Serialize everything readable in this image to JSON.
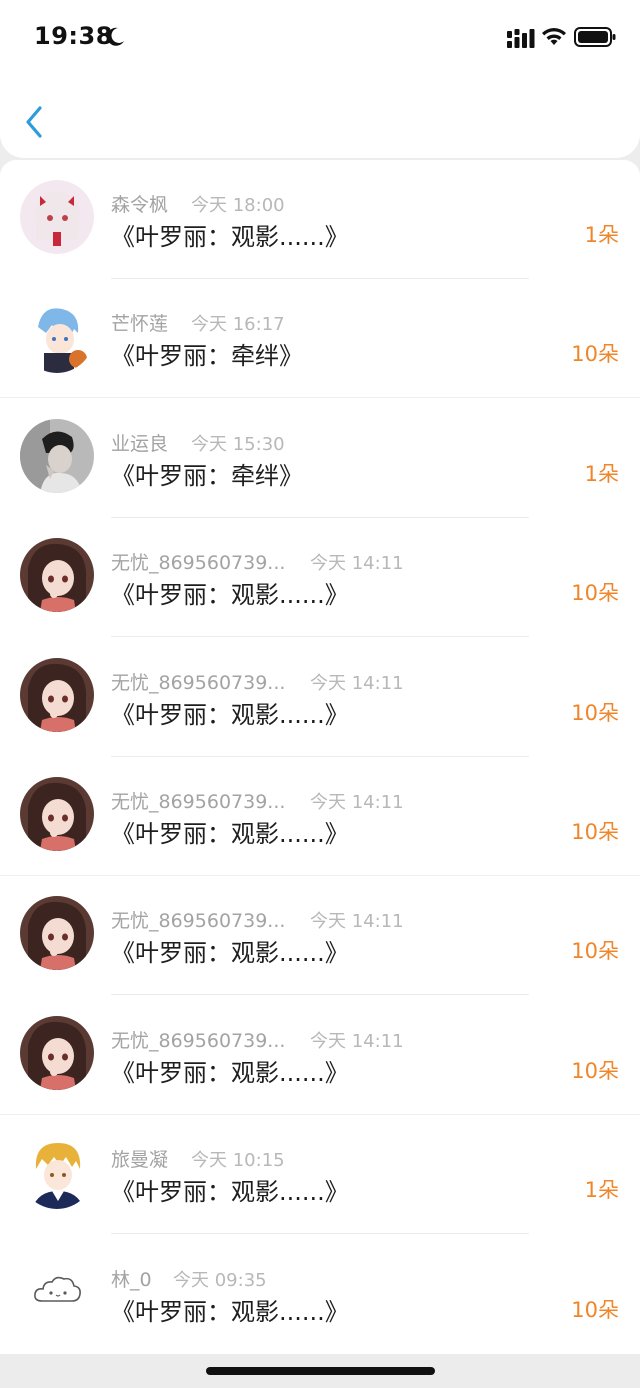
{
  "status_bar": {
    "time": "19:38"
  },
  "nav": {
    "back_icon": "chevron-left-icon"
  },
  "colors": {
    "accent_blue": "#2d9cdb",
    "count_orange": "#f0862a"
  },
  "gifts": [
    {
      "name": "森令枫",
      "time": "今天 18:00",
      "title": "《叶罗丽：观影......》",
      "count": "1朵",
      "avatar": "anime-girl-red-bows"
    },
    {
      "name": "芒怀莲",
      "time": "今天 16:17",
      "title": "《叶罗丽：牵绊》",
      "count": "10朵",
      "avatar": "anime-boy-basketball"
    },
    {
      "name": "业运良",
      "time": "今天 15:30",
      "title": "《叶罗丽：牵绊》",
      "count": "1朵",
      "avatar": "photo-boy-grey"
    },
    {
      "name": "无忧_869560739...",
      "time": "今天 14:11",
      "title": "《叶罗丽：观影......》",
      "count": "10朵",
      "avatar": "anime-girl-dark-hair"
    },
    {
      "name": "无忧_869560739...",
      "time": "今天 14:11",
      "title": "《叶罗丽：观影......》",
      "count": "10朵",
      "avatar": "anime-girl-dark-hair"
    },
    {
      "name": "无忧_869560739...",
      "time": "今天 14:11",
      "title": "《叶罗丽：观影......》",
      "count": "10朵",
      "avatar": "anime-girl-dark-hair"
    },
    {
      "name": "无忧_869560739...",
      "time": "今天 14:11",
      "title": "《叶罗丽：观影......》",
      "count": "10朵",
      "avatar": "anime-girl-dark-hair"
    },
    {
      "name": "无忧_869560739...",
      "time": "今天 14:11",
      "title": "《叶罗丽：观影......》",
      "count": "10朵",
      "avatar": "anime-girl-dark-hair"
    },
    {
      "name": "旅曼凝",
      "time": "今天 10:15",
      "title": "《叶罗丽：观影......》",
      "count": "1朵",
      "avatar": "anime-boy-blonde"
    },
    {
      "name": "林_0",
      "time": "今天 09:35",
      "title": "《叶罗丽：观影......》",
      "count": "10朵",
      "avatar": "cloud-face"
    }
  ]
}
